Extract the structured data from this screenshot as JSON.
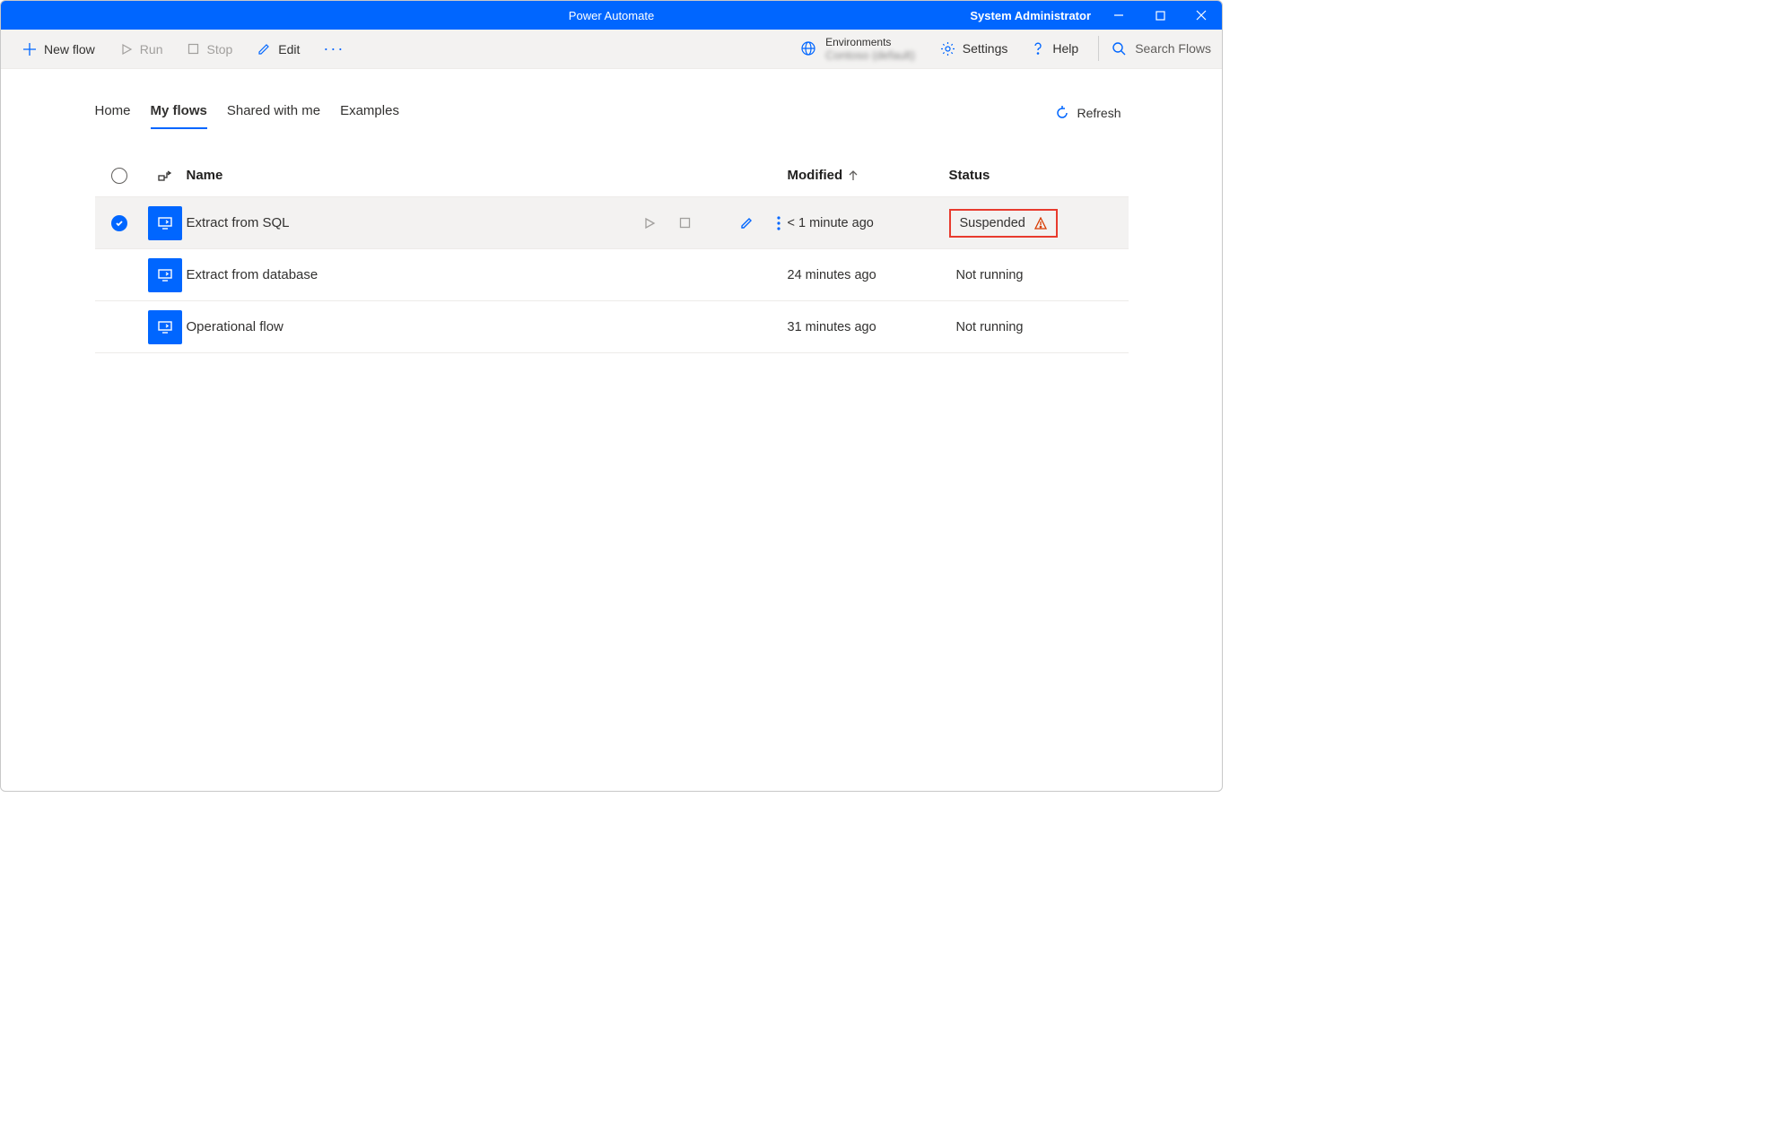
{
  "titlebar": {
    "app_title": "Power Automate",
    "user": "System Administrator"
  },
  "commandbar": {
    "new_flow": "New flow",
    "run": "Run",
    "stop": "Stop",
    "edit": "Edit",
    "environments_label": "Environments",
    "environments_value": "Contoso (default)",
    "settings": "Settings",
    "help": "Help",
    "search_placeholder": "Search Flows"
  },
  "tabs": {
    "home": "Home",
    "my_flows": "My flows",
    "shared": "Shared with me",
    "examples": "Examples",
    "refresh": "Refresh"
  },
  "table": {
    "headers": {
      "name": "Name",
      "modified": "Modified",
      "status": "Status"
    },
    "rows": [
      {
        "name": "Extract from SQL",
        "modified": "< 1 minute ago",
        "status": "Suspended",
        "selected": true,
        "warn": true
      },
      {
        "name": "Extract from database",
        "modified": "24 minutes ago",
        "status": "Not running",
        "selected": false,
        "warn": false
      },
      {
        "name": "Operational flow",
        "modified": "31 minutes ago",
        "status": "Not running",
        "selected": false,
        "warn": false
      }
    ]
  }
}
